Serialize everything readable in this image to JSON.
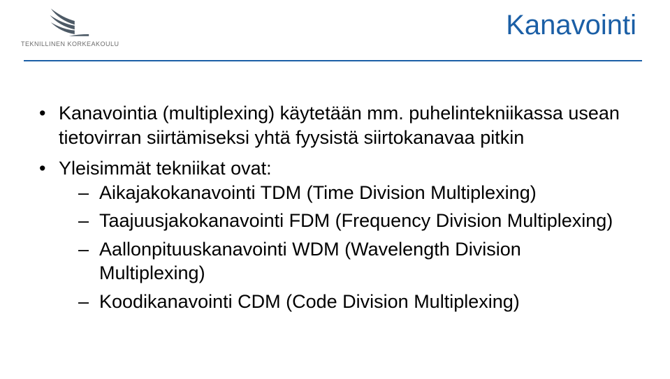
{
  "logo": {
    "caption": "TEKNILLINEN KORKEAKOULU"
  },
  "title": "Kanavointi",
  "bullets": [
    {
      "text": "Kanavointia (multiplexing) käytetään mm. puhelintekniikassa usean tietovirran siirtämiseksi yhtä fyysistä siirtokanavaa pitkin"
    },
    {
      "text": "Yleisimmät tekniikat ovat:",
      "sub": [
        "Aikajakokanavointi TDM (Time Division Multiplexing)",
        "Taajuusjakokanavointi FDM (Frequency Division Multiplexing)",
        "Aallonpituuskanavointi WDM (Wavelength Division Multiplexing)",
        "Koodikanavointi CDM (Code Division Multiplexing)"
      ]
    }
  ]
}
